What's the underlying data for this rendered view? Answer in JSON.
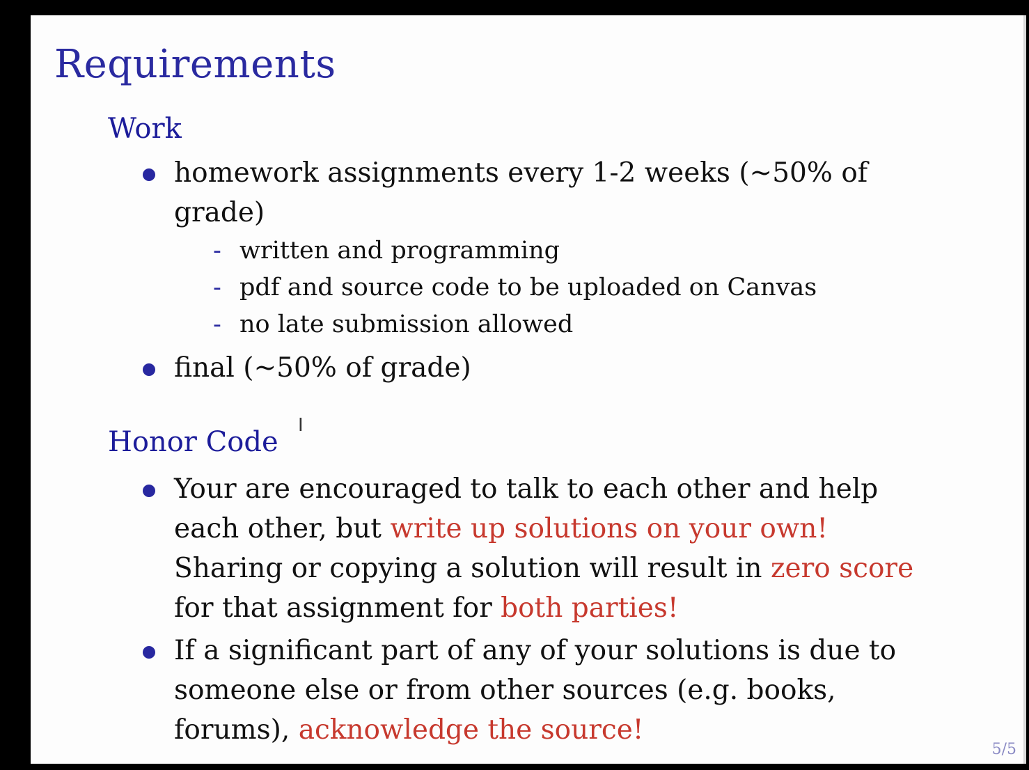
{
  "slide": {
    "title": "Requirements",
    "page_number": "5/5"
  },
  "work": {
    "heading": "Work",
    "bullet1": "homework assignments every 1-2 weeks (~50% of grade)",
    "sub_items": [
      "written and programming",
      "pdf and source code to be uploaded on Canvas",
      "no late submission allowed"
    ],
    "bullet2": "final (~50% of grade)"
  },
  "honor_code": {
    "heading": "Honor Code",
    "bullet1": {
      "part1": "Your are encouraged to talk to each other and help each other, but ",
      "highlight1": "write up solutions on your own!",
      "part2": " Sharing or copying a solution will result in ",
      "highlight2": "zero score",
      "part3": " for that assignment for ",
      "highlight3": "both parties!"
    },
    "bullet2": {
      "part1": "If a significant part of any of your solutions is due to someone else or from other sources (e.g. books, forums), ",
      "highlight1": "acknowledge the source!"
    }
  },
  "colors": {
    "heading": "#1c1c9a",
    "title": "#2a2aa0",
    "emphasis": "#c7392e",
    "bullet": "#2828a0"
  },
  "icons": {
    "cursor": "text-cursor-icon"
  }
}
